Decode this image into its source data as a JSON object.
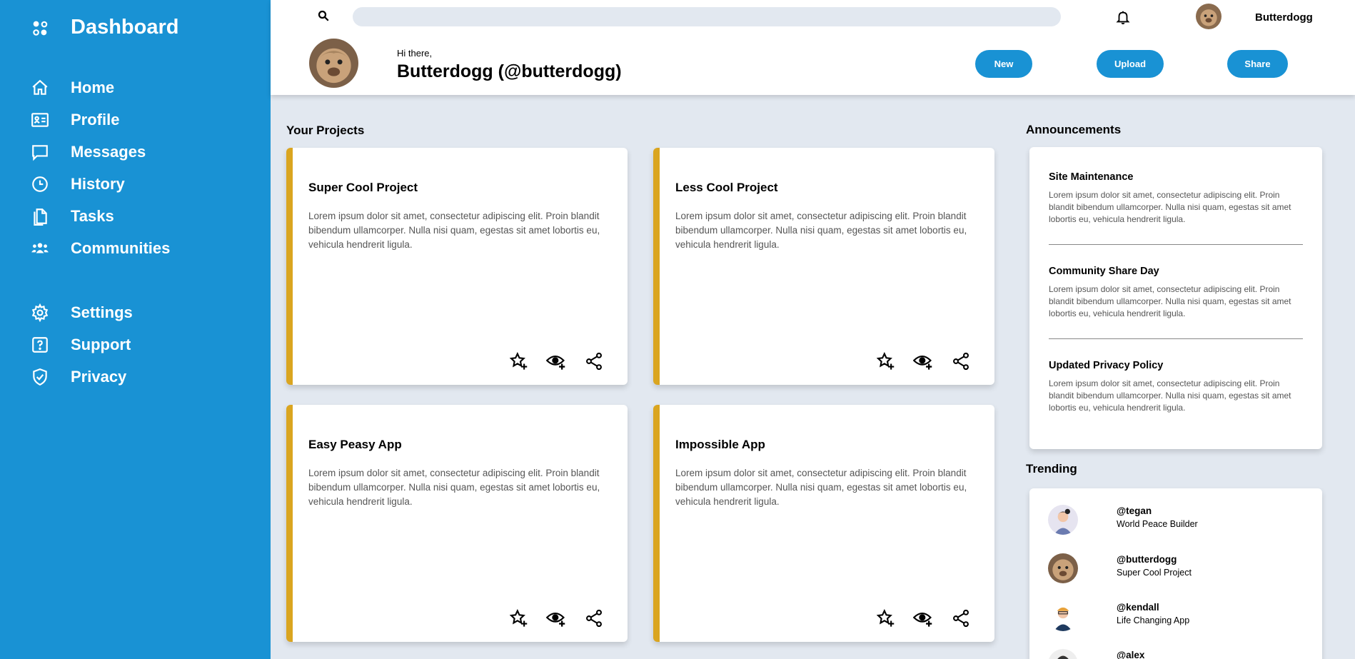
{
  "sidebar": {
    "brand": "Dashboard",
    "nav": [
      {
        "label": "Home",
        "icon": "home-icon"
      },
      {
        "label": "Profile",
        "icon": "profile-card-icon"
      },
      {
        "label": "Messages",
        "icon": "message-icon"
      },
      {
        "label": "History",
        "icon": "clock-icon"
      },
      {
        "label": "Tasks",
        "icon": "document-icon"
      },
      {
        "label": "Communities",
        "icon": "people-icon"
      }
    ],
    "nav2": [
      {
        "label": "Settings",
        "icon": "gear-icon"
      },
      {
        "label": "Support",
        "icon": "help-icon"
      },
      {
        "label": "Privacy",
        "icon": "shield-icon"
      }
    ]
  },
  "header": {
    "search_placeholder": "",
    "username": "Butterdogg",
    "greeting": "Hi there,",
    "full_name": "Butterdogg (@butterdogg)",
    "buttons": {
      "new": "New",
      "upload": "Upload",
      "share": "Share"
    }
  },
  "projects": {
    "title": "Your Projects",
    "items": [
      {
        "title": "Super Cool Project",
        "text": "Lorem ipsum dolor sit amet, consectetur adipiscing elit. Proin blandit bibendum ullamcorper. Nulla nisi quam, egestas sit amet lobortis eu, vehicula hendrerit ligula."
      },
      {
        "title": "Less Cool Project",
        "text": "Lorem ipsum dolor sit amet, consectetur adipiscing elit. Proin blandit bibendum ullamcorper. Nulla nisi quam, egestas sit amet lobortis eu, vehicula hendrerit ligula."
      },
      {
        "title": "Easy Peasy App",
        "text": "Lorem ipsum dolor sit amet, consectetur adipiscing elit. Proin blandit bibendum ullamcorper. Nulla nisi quam, egestas sit amet lobortis eu, vehicula hendrerit ligula."
      },
      {
        "title": "Impossible App",
        "text": "Lorem ipsum dolor sit amet, consectetur adipiscing elit. Proin blandit bibendum ullamcorper. Nulla nisi quam, egestas sit amet lobortis eu, vehicula hendrerit ligula."
      }
    ]
  },
  "announcements": {
    "title": "Announcements",
    "items": [
      {
        "title": "Site Maintenance",
        "text": "Lorem ipsum dolor sit amet, consectetur adipiscing elit. Proin blandit bibendum ullamcorper. Nulla nisi quam, egestas sit amet lobortis eu, vehicula hendrerit ligula."
      },
      {
        "title": "Community Share Day",
        "text": "Lorem ipsum dolor sit amet, consectetur adipiscing elit. Proin blandit bibendum ullamcorper. Nulla nisi quam, egestas sit amet lobortis eu, vehicula hendrerit ligula."
      },
      {
        "title": "Updated Privacy Policy",
        "text": "Lorem ipsum dolor sit amet, consectetur adipiscing elit. Proin blandit bibendum ullamcorper. Nulla nisi quam, egestas sit amet lobortis eu, vehicula hendrerit ligula."
      }
    ]
  },
  "trending": {
    "title": "Trending",
    "items": [
      {
        "handle": "@tegan",
        "desc": "World Peace Builder"
      },
      {
        "handle": "@butterdogg",
        "desc": "Super Cool Project"
      },
      {
        "handle": "@kendall",
        "desc": "Life Changing App"
      },
      {
        "handle": "@alex",
        "desc": ""
      }
    ]
  },
  "colors": {
    "primary": "#1992d4",
    "accent": "#daa520",
    "background": "#e2e8f0"
  }
}
